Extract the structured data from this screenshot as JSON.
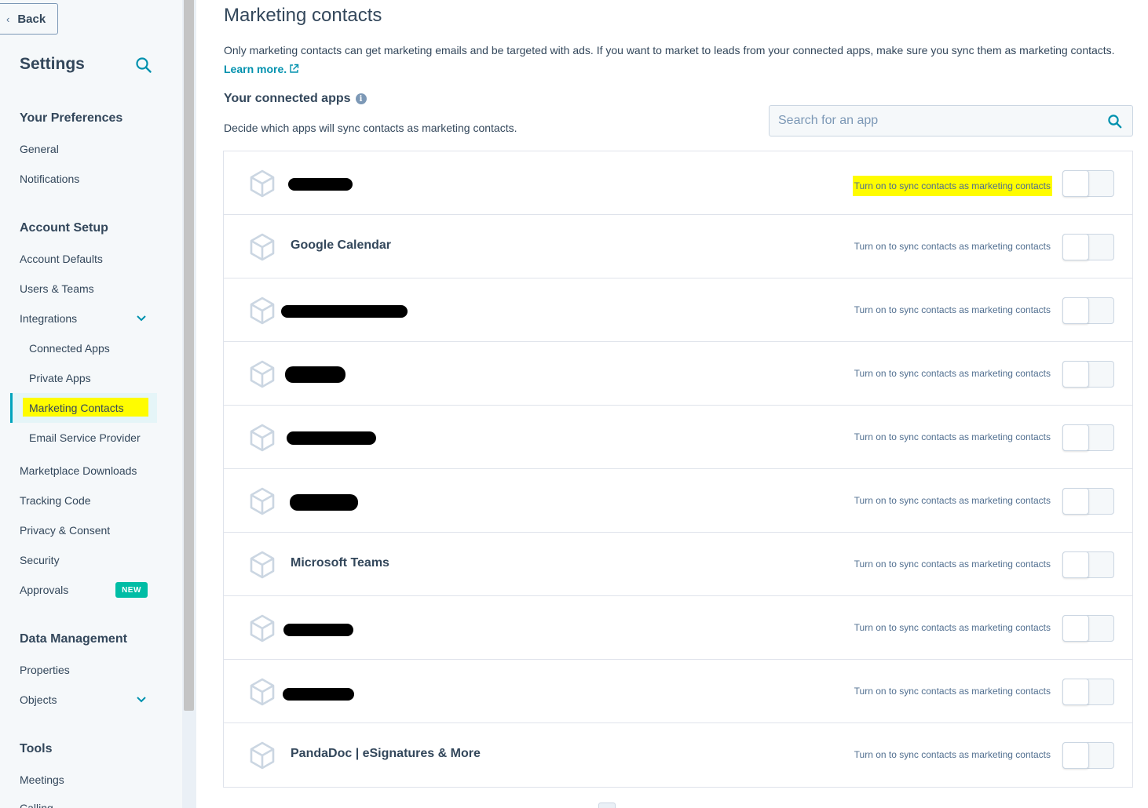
{
  "sidebar": {
    "back_label": "Back",
    "title": "Settings",
    "sections": {
      "preferences": "Your Preferences",
      "account_setup": "Account Setup",
      "data_management": "Data Management",
      "tools": "Tools"
    },
    "items": {
      "general": "General",
      "notifications": "Notifications",
      "account_defaults": "Account Defaults",
      "users_teams": "Users & Teams",
      "integrations": "Integrations",
      "connected_apps": "Connected Apps",
      "private_apps": "Private Apps",
      "marketing_contacts": "Marketing Contacts",
      "email_service_provider": "Email Service Provider",
      "marketplace_downloads": "Marketplace Downloads",
      "tracking_code": "Tracking Code",
      "privacy_consent": "Privacy & Consent",
      "security": "Security",
      "approvals": "Approvals",
      "properties": "Properties",
      "objects": "Objects",
      "meetings": "Meetings",
      "calling": "Calling"
    },
    "new_badge": "NEW"
  },
  "main": {
    "title": "Marketing contacts",
    "intro_text": "Only marketing contacts can get marketing emails and be targeted with ads. If you want to market to leads from your connected apps, make sure you sync them as marketing contacts.",
    "learn_more": "Learn more.",
    "section_title": "Your connected apps",
    "section_desc": "Decide which apps will sync contacts as marketing contacts.",
    "search_placeholder": "Search for an app",
    "sync_label": "Turn on to sync contacts as marketing contacts",
    "apps": [
      {
        "name": "",
        "redacted": true,
        "enabled": false
      },
      {
        "name": "Google Calendar",
        "redacted": false,
        "enabled": false
      },
      {
        "name": "",
        "redacted": true,
        "enabled": false
      },
      {
        "name": "",
        "redacted": true,
        "enabled": false
      },
      {
        "name": "",
        "redacted": true,
        "enabled": false
      },
      {
        "name": "",
        "redacted": true,
        "enabled": false
      },
      {
        "name": "Microsoft Teams",
        "redacted": false,
        "enabled": false
      },
      {
        "name": "",
        "redacted": true,
        "enabled": false
      },
      {
        "name": "",
        "redacted": true,
        "enabled": false
      },
      {
        "name": "PandaDoc | eSignatures & More",
        "redacted": false,
        "enabled": false
      }
    ]
  },
  "colors": {
    "accent": "#00a4bd",
    "link": "#0091ae",
    "badge": "#00bda5",
    "highlight": "#fffc00",
    "text": "#33475b"
  }
}
